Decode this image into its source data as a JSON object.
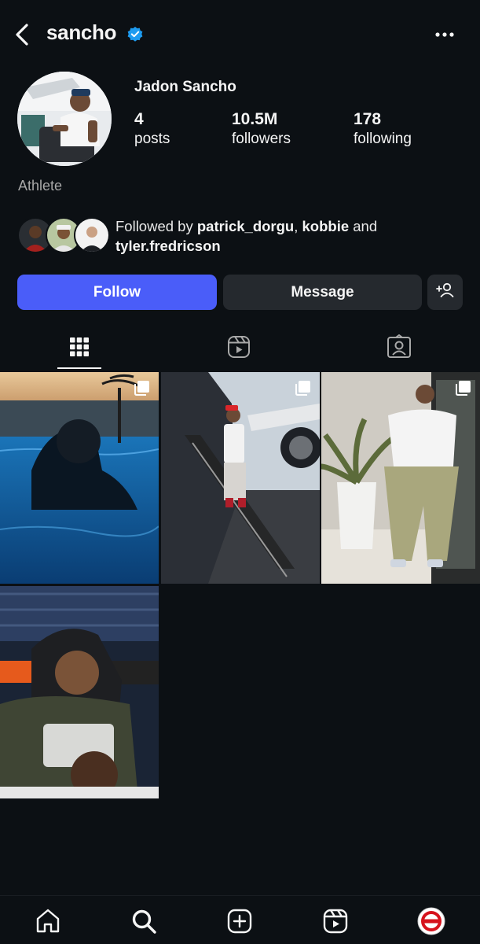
{
  "header": {
    "username": "sancho",
    "verified_icon": "verified-badge-icon",
    "back_icon": "chevron-left-icon",
    "more_icon": "more-horizontal-icon"
  },
  "profile": {
    "display_name": "Jadon Sancho",
    "category": "Athlete",
    "stats": [
      {
        "value": "4",
        "label": "posts"
      },
      {
        "value": "10.5M",
        "label": "followers"
      },
      {
        "value": "178",
        "label": "following"
      }
    ],
    "followed_by": {
      "prefix": "Followed by ",
      "user1": "patrick_dorgu",
      "sep": ", ",
      "user2": "kobbie",
      "and": " and",
      "user3": "tyler.fredricson"
    }
  },
  "actions": {
    "follow_label": "Follow",
    "message_label": "Message",
    "add_user_icon": "add-user-icon"
  },
  "tabs": [
    {
      "icon": "grid-icon",
      "active": true
    },
    {
      "icon": "reels-icon",
      "active": false
    },
    {
      "icon": "tagged-icon",
      "active": false
    }
  ],
  "posts": [
    {
      "subject": "pool-sunset",
      "multi": true
    },
    {
      "subject": "private-jet-stairs",
      "multi": true
    },
    {
      "subject": "indoor-portrait",
      "multi": true
    },
    {
      "subject": "stadium-bench",
      "multi": false
    }
  ],
  "bottom_nav": [
    {
      "icon": "home-icon"
    },
    {
      "icon": "search-icon"
    },
    {
      "icon": "create-icon"
    },
    {
      "icon": "reels-icon"
    },
    {
      "icon": "profile-avatar-icon"
    }
  ],
  "colors": {
    "background": "#0c1014",
    "follow_button": "#4a5df9",
    "secondary_button": "#25292e",
    "verified": "#1d9bf0"
  }
}
